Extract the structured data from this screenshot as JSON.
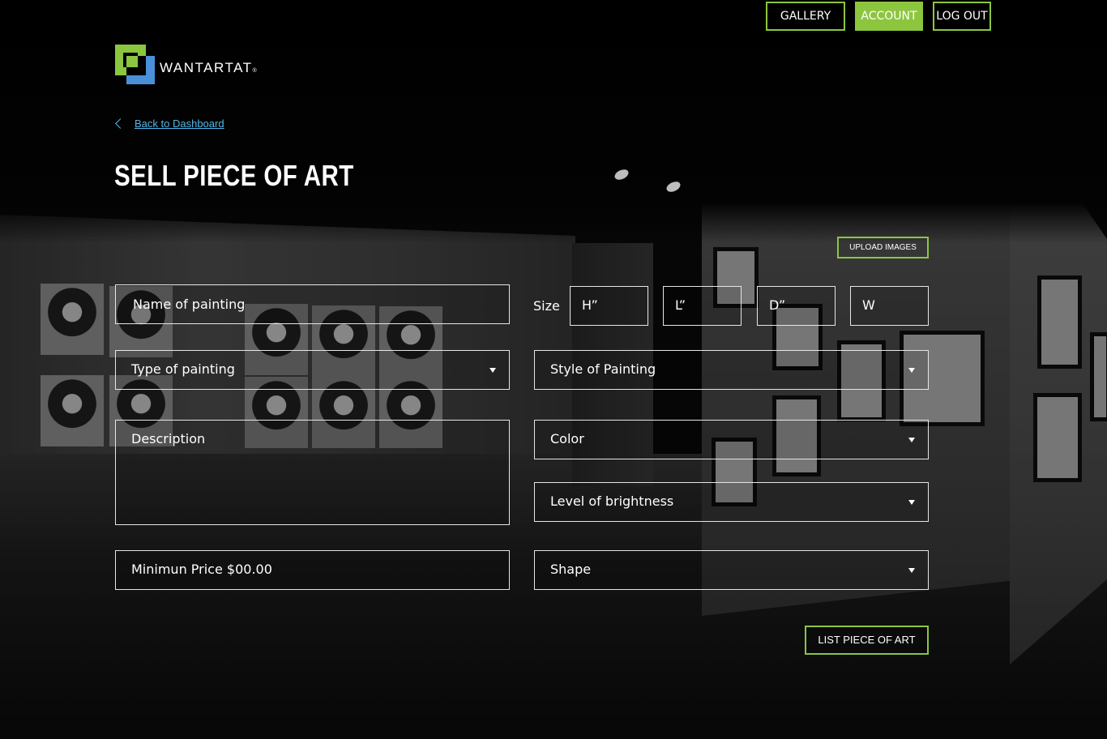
{
  "nav": {
    "gallery_label": "GALLERY",
    "account_label": "ACCOUNT",
    "logout_label": "LOG OUT"
  },
  "brand": {
    "name": "WANTARTAT",
    "registered": "®"
  },
  "back_link": "Back to Dashboard",
  "page_title": "SELL PIECE OF ART",
  "form": {
    "upload_images_label": "UPLOAD IMAGES",
    "name_placeholder": "Name of painting",
    "size_label": "Size",
    "size_h": "H”",
    "size_l": "L”",
    "size_d": "D”",
    "size_w": "W",
    "type_placeholder": "Type of painting",
    "style_placeholder": "Style of Painting",
    "description_placeholder": "Description",
    "color_placeholder": "Color",
    "brightness_placeholder": "Level of brightness",
    "price_placeholder": "Minimun Price $00.00",
    "shape_placeholder": "Shape",
    "submit_label": "LIST PIECE OF ART"
  },
  "colors": {
    "accent_green": "#8cc63f",
    "link_blue": "#4fb7e8",
    "logo_blue": "#4a90d9"
  },
  "icons": {
    "back": "chevron-left-icon",
    "dropdown": "caret-down-icon"
  }
}
